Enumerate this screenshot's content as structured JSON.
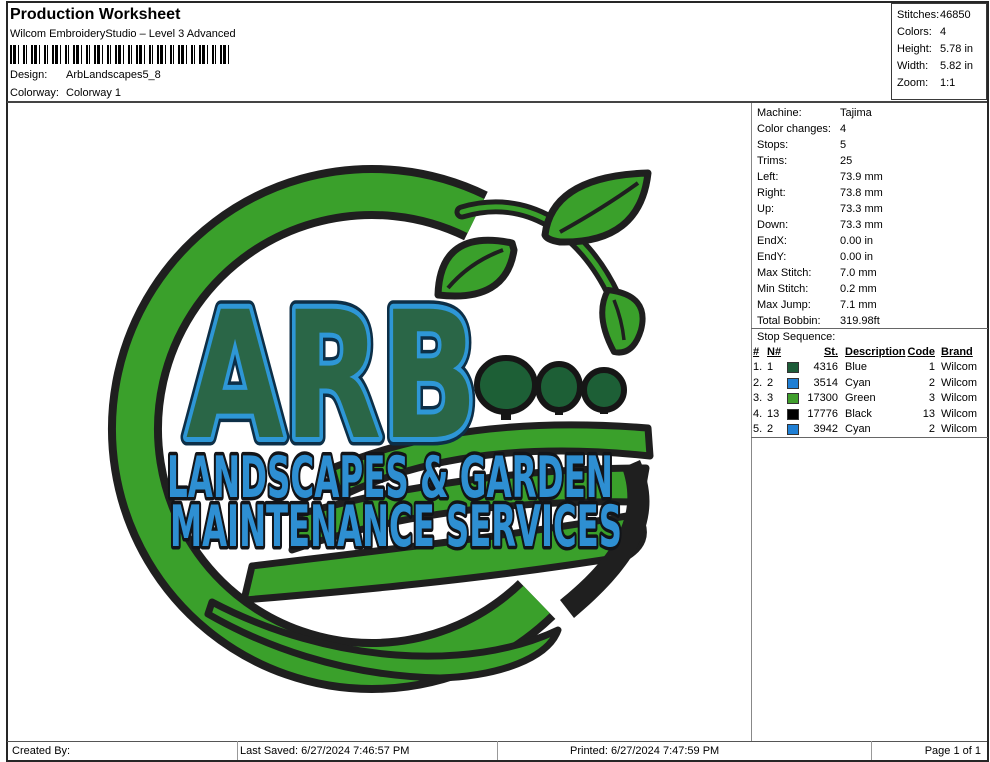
{
  "header": {
    "title": "Production Worksheet",
    "subtitle": "Wilcom EmbroideryStudio – Level 3 Advanced",
    "barcode_icon": "barcode",
    "fields": [
      {
        "label": "Design:",
        "value": "ArbLandscapes5_8"
      },
      {
        "label": "Colorway:",
        "value": "Colorway 1"
      }
    ]
  },
  "summary_box": {
    "rows": [
      {
        "label": "Stitches:",
        "value": "46850"
      },
      {
        "label": "Colors:",
        "value": "4"
      },
      {
        "label": "Height:",
        "value": "5.78 in"
      },
      {
        "label": "Width:",
        "value": "5.82 in"
      },
      {
        "label": "Zoom:",
        "value": "1:1"
      }
    ]
  },
  "machine_panel": {
    "rows": [
      {
        "label": "Machine:",
        "value": "Tajima"
      },
      {
        "label": "Color changes:",
        "value": "4"
      },
      {
        "label": "Stops:",
        "value": "5"
      },
      {
        "label": "Trims:",
        "value": "25"
      },
      {
        "label": "Left:",
        "value": "73.9 mm"
      },
      {
        "label": "Right:",
        "value": "73.8 mm"
      },
      {
        "label": "Up:",
        "value": "73.3 mm"
      },
      {
        "label": "Down:",
        "value": "73.3 mm"
      },
      {
        "label": "EndX:",
        "value": "0.00 in"
      },
      {
        "label": "EndY:",
        "value": "0.00 in"
      },
      {
        "label": "Max Stitch:",
        "value": "7.0 mm"
      },
      {
        "label": "Min Stitch:",
        "value": "0.2 mm"
      },
      {
        "label": "Max Jump:",
        "value": "7.1 mm"
      },
      {
        "label": "Total Bobbin:",
        "value": "319.98ft"
      }
    ]
  },
  "stop_sequence": {
    "title": "Stop Sequence:",
    "columns": {
      "num": "#",
      "needle": "N#",
      "stitches": "St.",
      "description": "Description",
      "code": "Code",
      "brand": "Brand"
    },
    "rows": [
      {
        "num": "1.",
        "needle": "1",
        "swatch_color": "#1d5c38",
        "stitches": "4316",
        "description": "Blue",
        "code": "1",
        "brand": "Wilcom"
      },
      {
        "num": "2.",
        "needle": "2",
        "swatch_color": "#1f7fd4",
        "stitches": "3514",
        "description": "Cyan",
        "code": "2",
        "brand": "Wilcom"
      },
      {
        "num": "3.",
        "needle": "3",
        "swatch_color": "#3f9e2c",
        "stitches": "17300",
        "description": "Green",
        "code": "3",
        "brand": "Wilcom"
      },
      {
        "num": "4.",
        "needle": "13",
        "swatch_color": "#000000",
        "stitches": "17776",
        "description": "Black",
        "code": "13",
        "brand": "Wilcom"
      },
      {
        "num": "5.",
        "needle": "2",
        "swatch_color": "#1f7fd4",
        "stitches": "3942",
        "description": "Cyan",
        "code": "2",
        "brand": "Wilcom"
      }
    ]
  },
  "design_preview": {
    "monogram": "ARB",
    "tagline_line1": "LANDSCAPES & GARDEN",
    "tagline_line2": "MAINTENANCE SERVICES",
    "icons": [
      "ring-icon",
      "leaf-icon",
      "tree-icon",
      "wave-icon"
    ],
    "colors": {
      "ring_green": "#3aa02b",
      "dark_green": "#1d5f36",
      "outline_black": "#1f1f1f",
      "letter_blue": "#2e97d6",
      "letter_fill": "#2a6647",
      "tagline_blue": "#2e8fd2"
    }
  },
  "footer": {
    "created_by_label": "Created By:",
    "last_saved": "Last Saved: 6/27/2024 7:46:57 PM",
    "printed": "Printed: 6/27/2024 7:47:59 PM",
    "page_label": "Page 1 of 1"
  }
}
